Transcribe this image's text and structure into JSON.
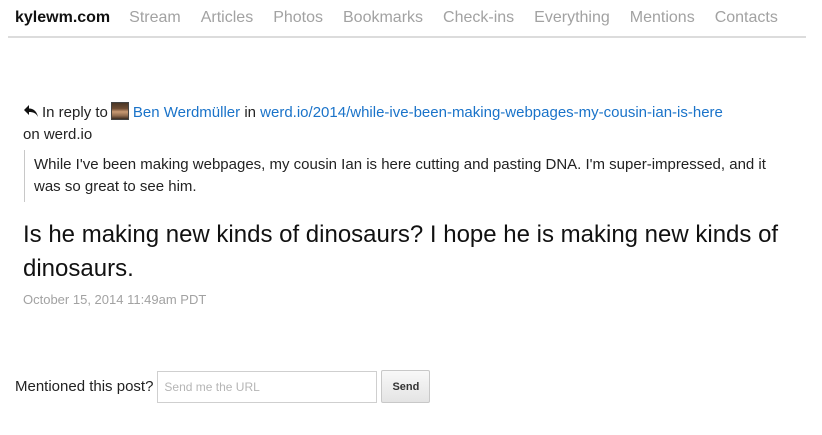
{
  "nav": {
    "brand": "kylewm.com",
    "links": [
      "Stream",
      "Articles",
      "Photos",
      "Bookmarks",
      "Check-ins",
      "Everything",
      "Mentions",
      "Contacts"
    ]
  },
  "reply": {
    "prefix": "In reply to",
    "author": "Ben Werdmüller",
    "in_word": "in",
    "url": "werd.io/2014/while-ive-been-making-webpages-my-cousin-ian-is-here",
    "on_text": "on werd.io",
    "quote": "While I've been making webpages, my cousin Ian is here cutting and pasting DNA. I'm super-impressed, and it was so great to see him."
  },
  "post": {
    "body": "Is he making new kinds of dinosaurs? I hope he is making new kinds of dinosaurs.",
    "date": "October 15, 2014 11:49am PDT"
  },
  "mention_form": {
    "label": "Mentioned this post?",
    "placeholder": "Send me the URL",
    "value": "",
    "send_label": "Send"
  },
  "colors": {
    "link": "#1a73c9",
    "nav_muted": "#a2a2a2"
  }
}
